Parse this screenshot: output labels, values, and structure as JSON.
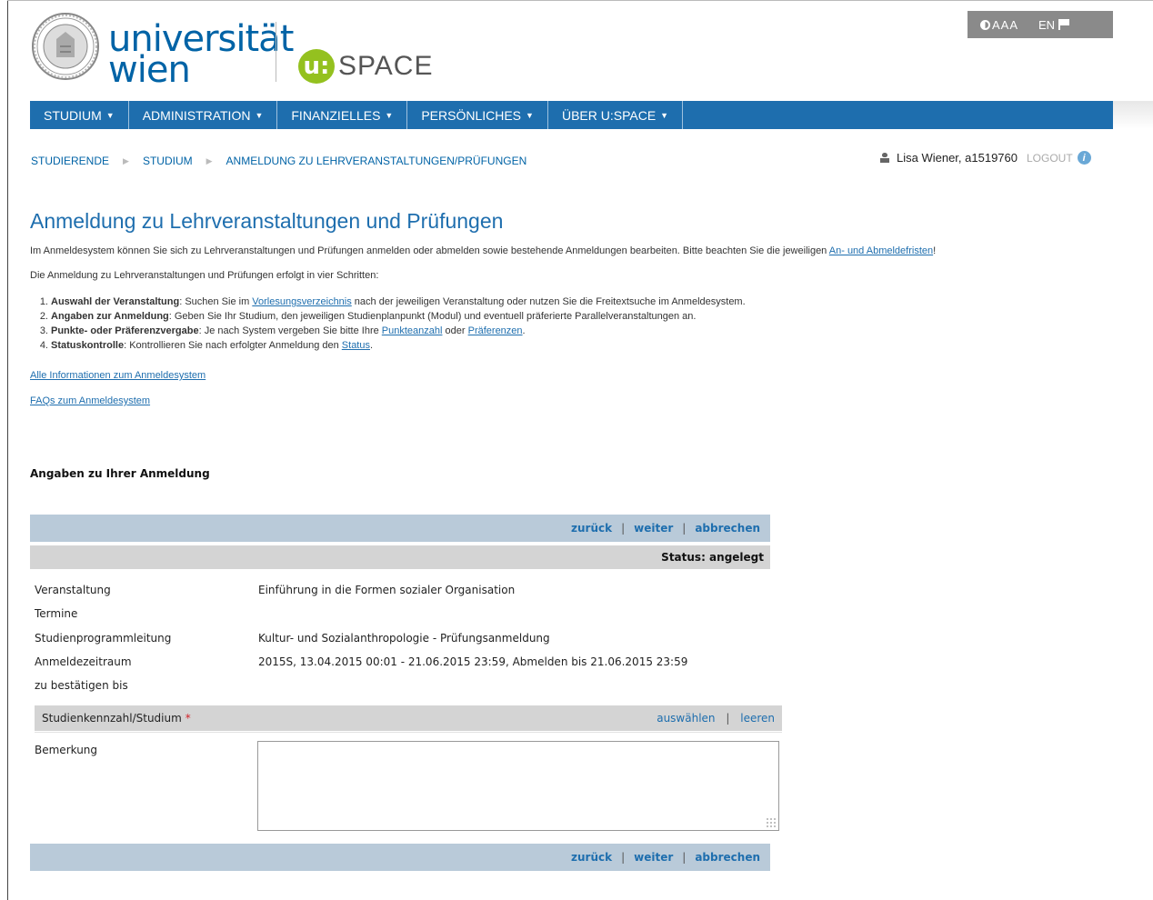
{
  "toolbar": {
    "accessibility_label": "AAA",
    "language_label": "EN"
  },
  "logo": {
    "university_line1": "universität",
    "university_line2": "wien",
    "uspace_badge": "u:",
    "uspace_text": "SPACE"
  },
  "nav": {
    "items": [
      {
        "label": "STUDIUM"
      },
      {
        "label": "ADMINISTRATION"
      },
      {
        "label": "FINANZIELLES"
      },
      {
        "label": "PERSÖNLICHES"
      },
      {
        "label": "ÜBER U:SPACE"
      }
    ]
  },
  "breadcrumb": [
    "STUDIERENDE",
    "STUDIUM",
    "ANMELDUNG ZU LEHRVERANSTALTUNGEN/PRÜFUNGEN"
  ],
  "user": {
    "name": "Lisa Wiener, a1519760",
    "logout": "LOGOUT"
  },
  "page": {
    "title": "Anmeldung zu Lehrveranstaltungen und Prüfungen",
    "intro_text": "Im Anmeldesystem können Sie sich zu Lehrveranstaltungen und Prüfungen anmelden oder abmelden sowie bestehende Anmeldungen bearbeiten. Bitte beachten Sie die jeweiligen ",
    "intro_link": "An- und Abmeldefristen",
    "intro_end": "!",
    "intro2": "Die Anmeldung zu Lehrveranstaltungen und Prüfungen erfolgt in vier Schritten:",
    "steps": [
      {
        "num": "1.",
        "bold": "Auswahl der Veranstaltung",
        "text1": ": Suchen Sie im ",
        "link1": "Vorlesungsverzeichnis",
        "text2": " nach der jeweiligen Veranstaltung oder nutzen Sie die Freitextsuche im Anmeldesystem.",
        "link2": "",
        "text3": ""
      },
      {
        "num": "2.",
        "bold": "Angaben zur Anmeldung",
        "text1": ": Geben Sie Ihr Studium, den jeweiligen Studienplanpunkt (Modul) und eventuell präferierte Parallelveranstaltungen an.",
        "link1": "",
        "text2": "",
        "link2": "",
        "text3": ""
      },
      {
        "num": "3.",
        "bold": "Punkte- oder Präferenzvergabe",
        "text1": ": Je nach System vergeben Sie bitte Ihre ",
        "link1": "Punkteanzahl",
        "text2": " oder ",
        "link2": "Präferenzen",
        "text3": "."
      },
      {
        "num": "4.",
        "bold": "Statuskontrolle",
        "text1": ": Kontrollieren Sie nach erfolgter Anmeldung den ",
        "link1": "Status",
        "text2": ".",
        "link2": "",
        "text3": ""
      }
    ],
    "link_all": "Alle Informationen zum Anmeldesystem",
    "link_faq": "FAQs zum Anmeldesystem"
  },
  "form": {
    "section_title": "Angaben zu Ihrer Anmeldung",
    "actions": {
      "back": "zurück",
      "next": "weiter",
      "cancel": "abbrechen",
      "separator": "|"
    },
    "status": "Status: angelegt",
    "rows": {
      "veranstaltung": {
        "label": "Veranstaltung",
        "value": "Einführung in die Formen sozialer Organisation"
      },
      "termine": {
        "label": "Termine",
        "value": ""
      },
      "studienprogrammleitung": {
        "label": "Studienprogrammleitung",
        "value": "Kultur- und Sozialanthropologie - Prüfungsanmeldung"
      },
      "anmeldezeitraum": {
        "label": "Anmeldezeitraum",
        "value": "2015S, 13.04.2015 00:01 - 21.06.2015 23:59, Abmelden bis 21.06.2015 23:59"
      },
      "bestaetigen": {
        "label": "zu bestätigen bis",
        "value": ""
      }
    },
    "studium": {
      "label": "Studienkennzahl/Studium",
      "required": "*",
      "select": "auswählen",
      "clear": "leeren",
      "separator": "|"
    },
    "remark": {
      "label": "Bemerkung",
      "value": ""
    }
  }
}
